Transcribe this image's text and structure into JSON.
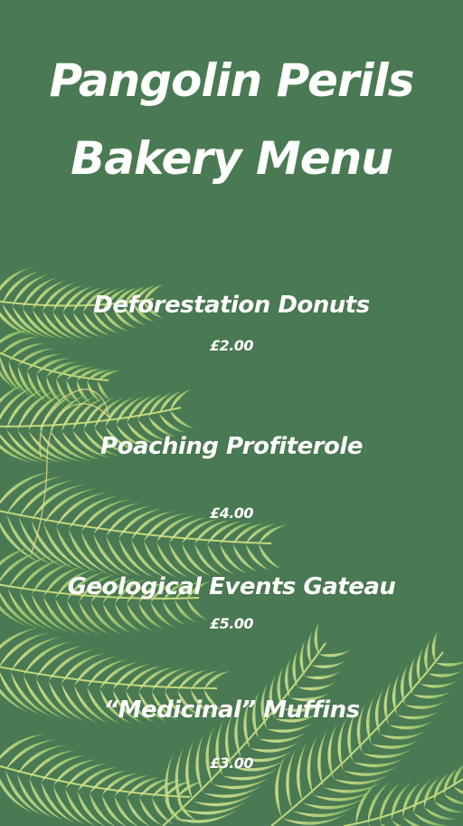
{
  "header": {
    "title_line_1": "Pangolin Perils",
    "title_line_2": "Bakery Menu"
  },
  "menu": {
    "items": [
      {
        "name": "Deforestation Donuts",
        "price": "£2.00"
      },
      {
        "name": "Poaching Profiterole",
        "price": "£4.00"
      },
      {
        "name": "Geological Events Gateau",
        "price": "£5.00"
      },
      {
        "name": "“Medicinal” Muffins",
        "price": "£3.00"
      }
    ]
  },
  "colors": {
    "background": "#4a7a53",
    "text": "#ffffff",
    "leaf_light": "#dfe98f",
    "leaf_mid": "#b5d877",
    "leaf_dark": "#7fba5c",
    "accent_line": "#e8d690"
  },
  "decorations": {
    "foliage": "palm-leaves-illustration"
  }
}
